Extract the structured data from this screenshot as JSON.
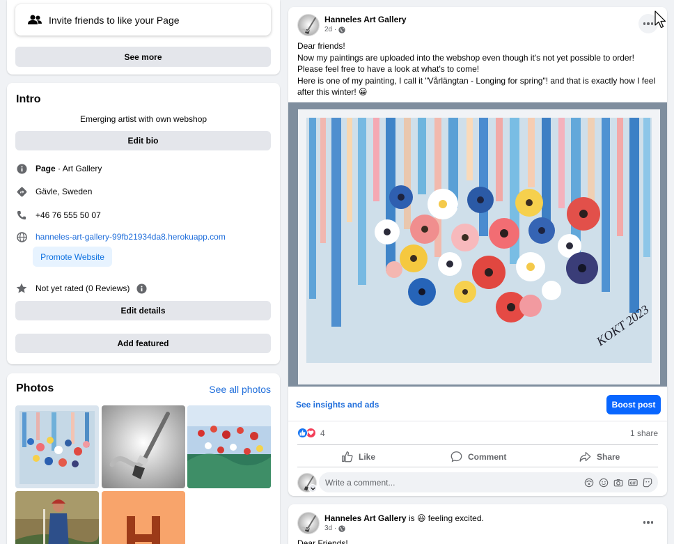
{
  "invite": {
    "label": "Invite friends to like your Page",
    "see_more": "See more"
  },
  "intro": {
    "title": "Intro",
    "bio": "Emerging artist with own webshop",
    "edit_bio": "Edit bio",
    "category_bold": "Page",
    "category_rest": " · Art Gallery",
    "location": "Gävle, Sweden",
    "phone": "+46 76 555 50 07",
    "website": "hanneles-art-gallery-99fb21934da8.herokuapp.com",
    "promote": "Promote Website",
    "rating": "Not yet rated (0 Reviews)",
    "edit_details": "Edit details",
    "add_featured": "Add featured"
  },
  "photos": {
    "title": "Photos",
    "see_all": "See all photos"
  },
  "post1": {
    "author": "Hanneles Art Gallery",
    "time": "2d ·",
    "text_lines": [
      "Dear friends!",
      "Now my paintings are uploaded into the webshop even though it's not yet possible to order!",
      "Please feel free to have a look at what's to come!",
      "Here is one of my painting, I call it \"Vårlängtan - Longing for spring\"! and that is exactly how I feel",
      "after this winter! 😀"
    ],
    "painting_signature": "KOKT 2023",
    "insights": "See insights and ads",
    "boost": "Boost post",
    "reactions_count": "4",
    "shares": "1 share",
    "like": "Like",
    "comment": "Comment",
    "share": "Share",
    "comment_placeholder": "Write a comment..."
  },
  "post2": {
    "author": "Hanneles Art Gallery",
    "is_text": " is 😃 feeling excited.",
    "time": "3d ·",
    "text_first": "Dear Friends!"
  },
  "colors": {
    "accent": "#0866ff",
    "link": "#216fdb",
    "page_bg": "#f0f2f5",
    "button_gray": "#e4e6eb"
  }
}
